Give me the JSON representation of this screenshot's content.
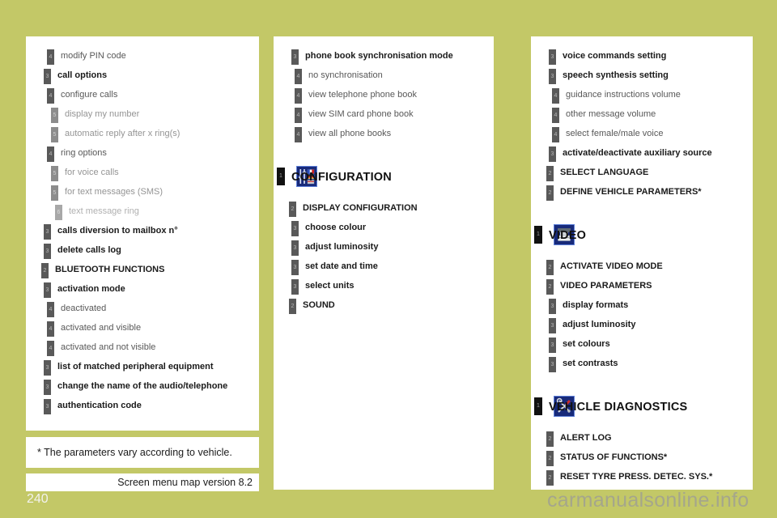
{
  "page": {
    "number": "240",
    "watermark": "carmanualsonline.info",
    "background_color": "#c3c867",
    "panel_color": "#ffffff"
  },
  "footer": {
    "note": "* The parameters vary according to vehicle.",
    "version": "Screen menu map version 8.2"
  },
  "columns": {
    "left": {
      "rows": [
        {
          "level": 4,
          "label": "modify PIN code"
        },
        {
          "level": 3,
          "label": "call options"
        },
        {
          "level": 4,
          "label": "configure calls"
        },
        {
          "level": 5,
          "label": "display my number"
        },
        {
          "level": 5,
          "label": "automatic reply after x ring(s)"
        },
        {
          "level": 4,
          "label": "ring options"
        },
        {
          "level": 5,
          "label": "for voice calls"
        },
        {
          "level": 5,
          "label": "for text messages (SMS)"
        },
        {
          "level": 6,
          "label": "text message ring"
        },
        {
          "level": 3,
          "label": "calls diversion to mailbox n°"
        },
        {
          "level": 3,
          "label": "delete calls log"
        },
        {
          "level": 2,
          "label": "BLUETOOTH FUNCTIONS"
        },
        {
          "level": 3,
          "label": "activation mode"
        },
        {
          "level": 4,
          "label": "deactivated"
        },
        {
          "level": 4,
          "label": "activated and visible"
        },
        {
          "level": 4,
          "label": "activated and not visible"
        },
        {
          "level": 3,
          "label": "list of matched peripheral equipment"
        },
        {
          "level": 3,
          "label": "change the name of the audio/telephone"
        },
        {
          "level": 3,
          "label": "authentication code"
        }
      ]
    },
    "middle": {
      "rows": [
        {
          "level": 3,
          "label": "phone book synchronisation mode"
        },
        {
          "level": 4,
          "label": "no synchronisation"
        },
        {
          "level": 4,
          "label": "view telephone phone book"
        },
        {
          "level": 4,
          "label": "view SIM card phone book"
        },
        {
          "level": 4,
          "label": "view all phone books"
        }
      ],
      "section": {
        "icon": "sliders-flags-icon",
        "level": 1,
        "label": "CONFIGURATION",
        "rows": [
          {
            "level": 2,
            "label": "DISPLAY CONFIGURATION"
          },
          {
            "level": 3,
            "label": "choose colour"
          },
          {
            "level": 3,
            "label": "adjust luminosity"
          },
          {
            "level": 3,
            "label": "set date and time"
          },
          {
            "level": 3,
            "label": "select units"
          },
          {
            "level": 2,
            "label": "SOUND"
          }
        ]
      }
    },
    "right": {
      "rows": [
        {
          "level": 3,
          "label": "voice commands setting"
        },
        {
          "level": 3,
          "label": "speech synthesis setting"
        },
        {
          "level": 4,
          "label": "guidance instructions volume"
        },
        {
          "level": 4,
          "label": "other message volume"
        },
        {
          "level": 4,
          "label": "select female/male voice"
        },
        {
          "level": 3,
          "label": "activate/deactivate auxiliary source"
        },
        {
          "level": 2,
          "label": "SELECT LANGUAGE"
        },
        {
          "level": 2,
          "label": "DEFINE VEHICLE PARAMETERS*"
        }
      ],
      "section_video": {
        "icon": "video-screen-icon",
        "level": 1,
        "label": "VIDEO",
        "rows": [
          {
            "level": 2,
            "label": "ACTIVATE VIDEO MODE"
          },
          {
            "level": 2,
            "label": "VIDEO PARAMETERS"
          },
          {
            "level": 3,
            "label": "display formats"
          },
          {
            "level": 3,
            "label": "adjust luminosity"
          },
          {
            "level": 3,
            "label": "set colours"
          },
          {
            "level": 3,
            "label": "set contrasts"
          }
        ]
      },
      "section_diagnostics": {
        "icon": "crossed-tools-icon",
        "level": 1,
        "label": "VEHICLE DIAGNOSTICS",
        "rows": [
          {
            "level": 2,
            "label": "ALERT LOG"
          },
          {
            "level": 2,
            "label": "STATUS OF FUNCTIONS*"
          },
          {
            "level": 2,
            "label": "RESET TYRE PRESS. DETEC. SYS.*"
          }
        ]
      }
    }
  }
}
